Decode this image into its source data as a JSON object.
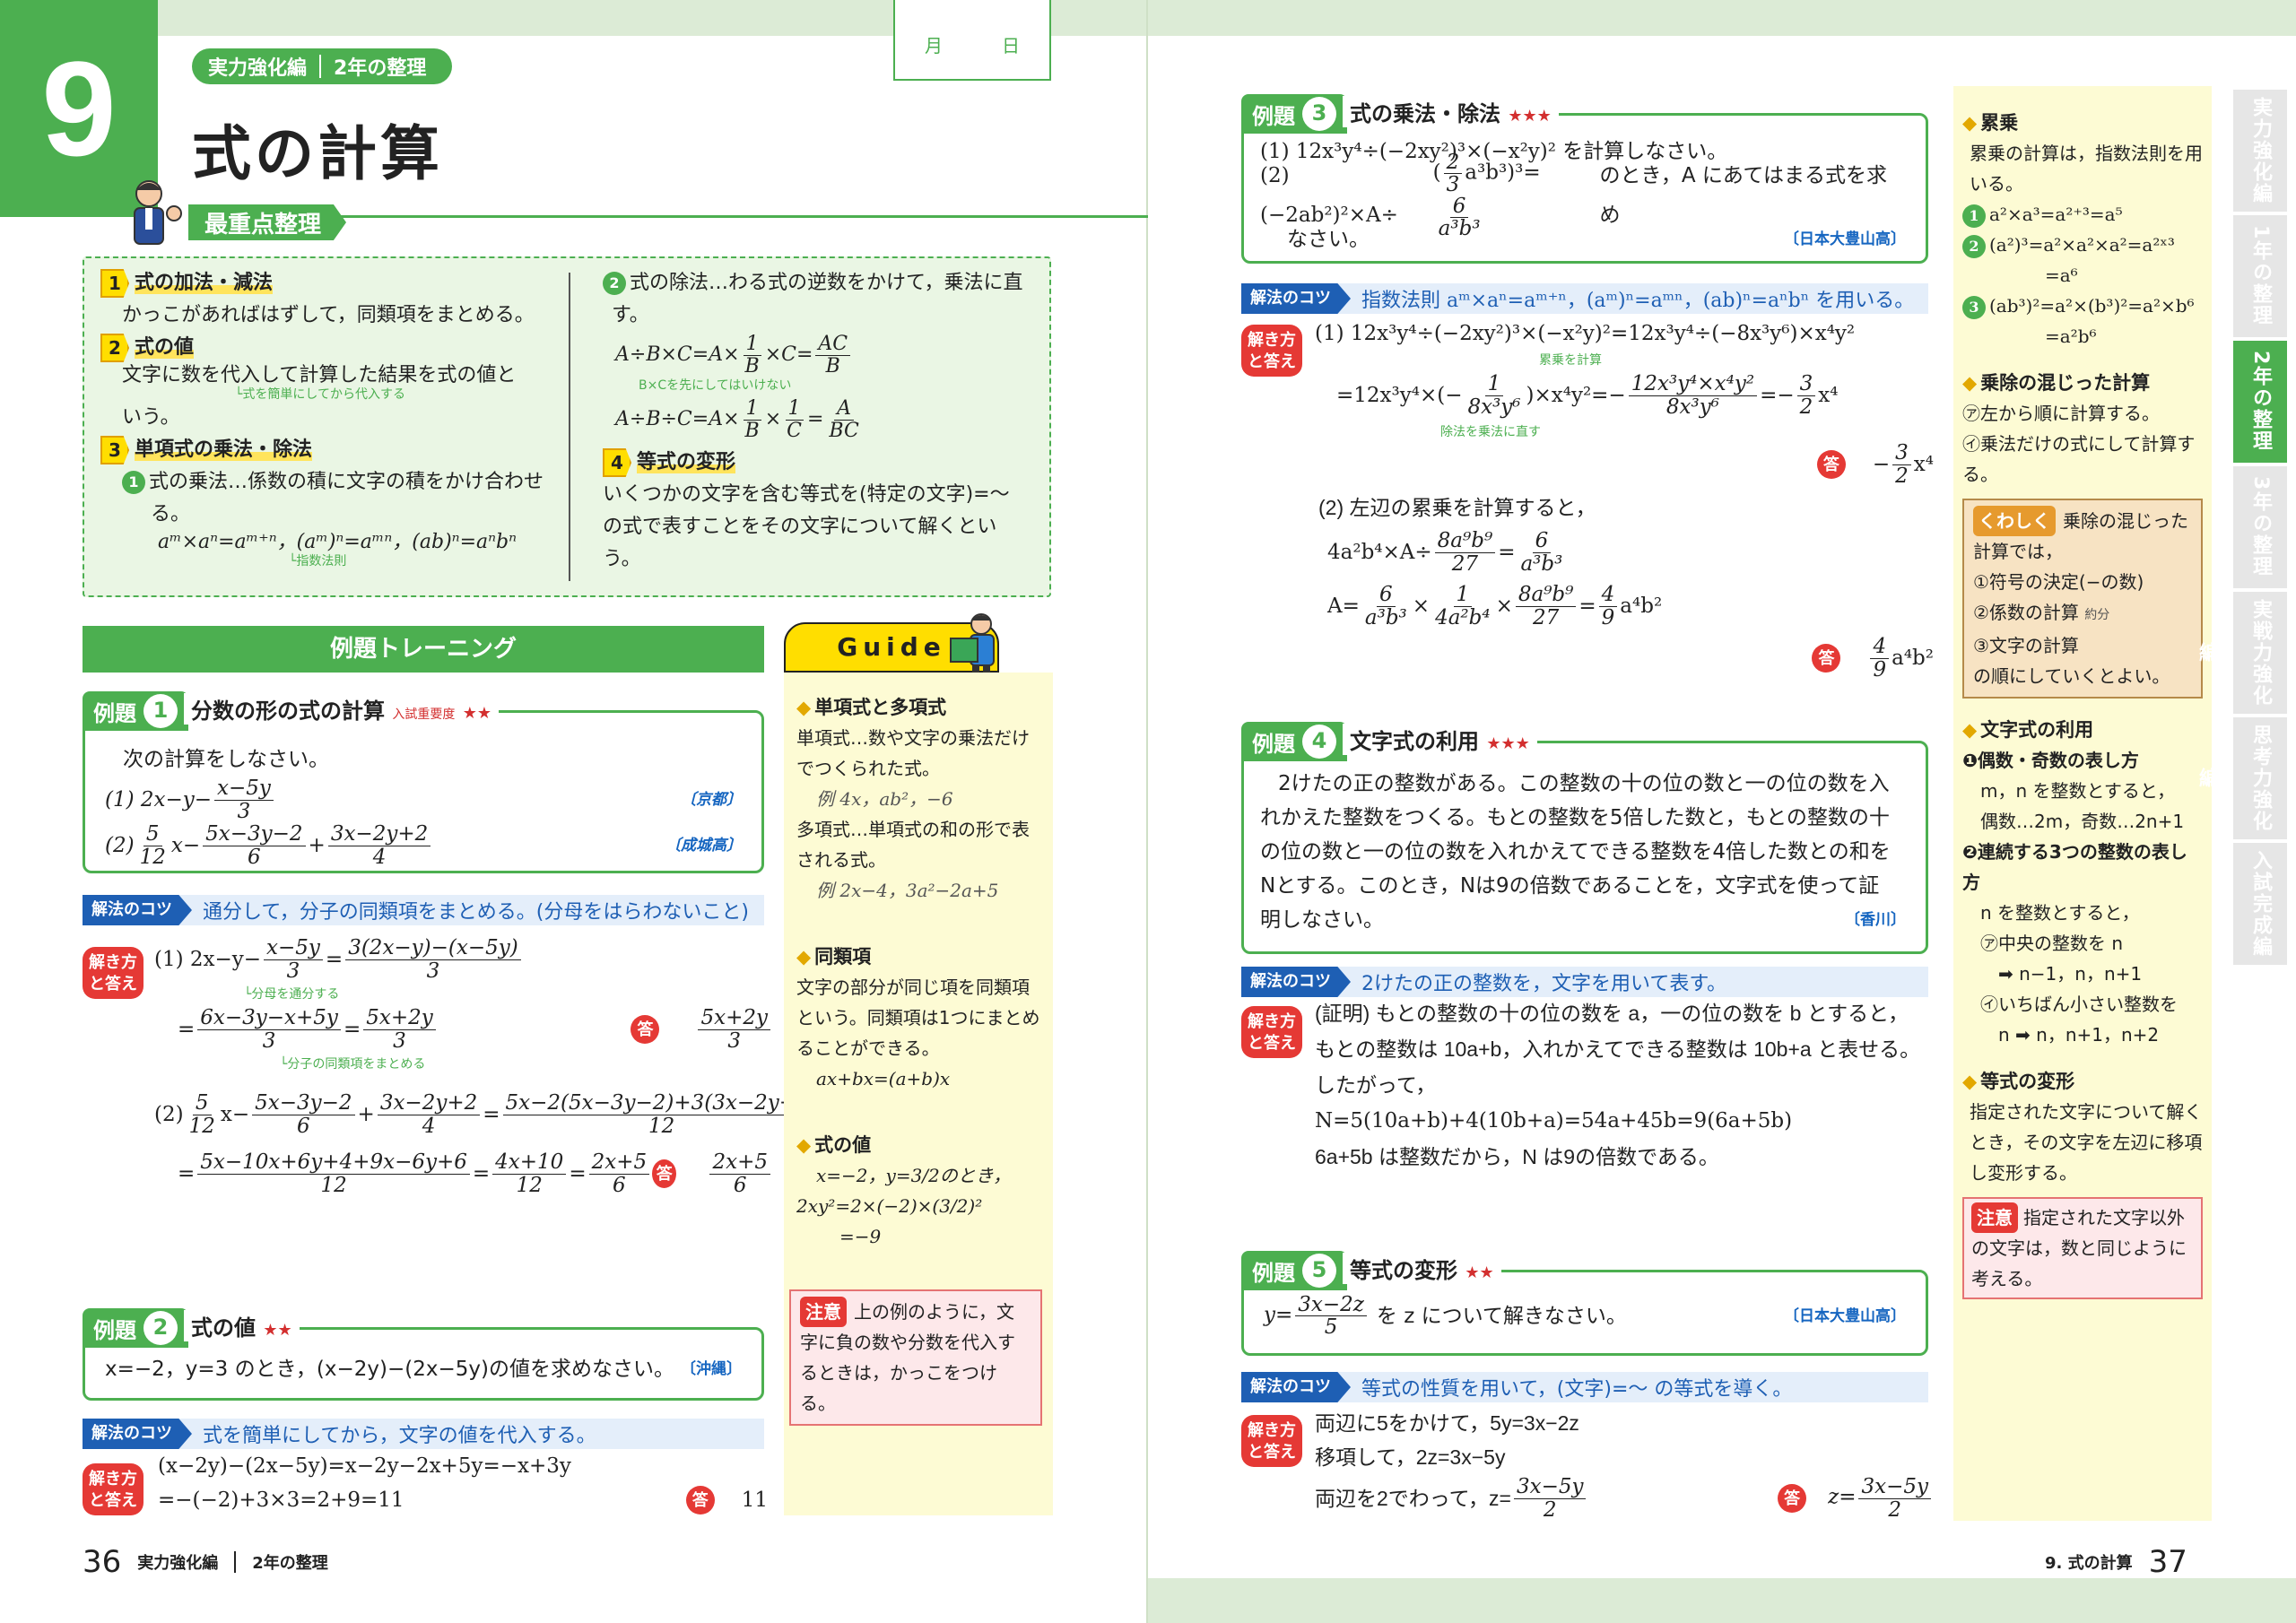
{
  "left": {
    "chapter_number": "9",
    "section_pill": {
      "a": "実力強化編",
      "b": "2年の整理"
    },
    "date_box": {
      "month": "月",
      "day": "日"
    },
    "title": "式の計算",
    "key_tag": "最重点整理",
    "key": {
      "item1": {
        "num": "1",
        "title": "式の加法・減法",
        "text": "かっこがあればはずして，同類項をまとめる。"
      },
      "item2": {
        "num": "2",
        "title": "式の値",
        "text1": "文字に数を代入して計算した結果を式の値と",
        "note": "└式を簡単にしてから代入する",
        "text2": "いう。"
      },
      "item3": {
        "num": "3",
        "title": "単項式の乗法・除法",
        "sub1": "式の乗法…係数の積に文字の積をかけ合わせ",
        "sub1b": "る。",
        "law": "aᵐ×aⁿ=aᵐ⁺ⁿ，(aᵐ)ⁿ=aᵐⁿ，(ab)ⁿ=aⁿbⁿ",
        "law_note": "└指数法則"
      },
      "div": {
        "title": "式の除法…わる式の逆数をかけて，乗法に直",
        "title2": "す。",
        "eq1": "A÷B×C=A×",
        "eq1_note": "B×Cを先にしてはいけない",
        "eq2": "A÷B÷C=A×"
      },
      "item4": {
        "num": "4",
        "title": "等式の変形",
        "text1": "いくつかの文字を含む等式を(特定の文字)=〜",
        "text2": "の式で表すことをその文字について解くとい",
        "text3": "う。"
      }
    },
    "training_bar": "例題トレーニング",
    "guide_head": "Guide",
    "ex1": {
      "label": "例題",
      "num": "1",
      "name": "分数の形の式の計算",
      "small": "入試重要度",
      "stars": "★★",
      "q": "次の計算をしなさい。",
      "p1": "(1) 2x−y−",
      "p1_src": "〔京都〕",
      "p2": "(2)",
      "p2_src": "〔成城高〕"
    },
    "kotsu1": {
      "label": "解法のコツ",
      "text": "通分して，分子の同類項をまとめる。(分母をはらわないこと)"
    },
    "ans_badge": "解き方と答え",
    "ans1": {
      "l1": "(1) 2x−y−",
      "note1": "└分母を通分する",
      "note2": "└分子の同類項をまとめる",
      "l3": "(2)"
    },
    "ex2": {
      "label": "例題",
      "num": "2",
      "name": "式の値",
      "stars": "★★",
      "q": "x=−2，y=3 のとき，(x−2y)−(2x−5y)の値を求めなさい。",
      "src": "〔沖縄〕"
    },
    "kotsu2": {
      "label": "解法のコツ",
      "text": "式を簡単にしてから，文字の値を代入する。"
    },
    "ans2": {
      "l1": "(x−2y)−(2x−5y)=x−2y−2x+5y=−x+3y",
      "l2": "=−(−2)+3×3=2+9=11",
      "final": "11"
    },
    "guide": {
      "h1": "単項式と多項式",
      "g1": "単項式…数や文字の乗法だけでつくられた式。",
      "g1e": "例 4x，ab²，−6",
      "g2": "多項式…単項式の和の形で表される式。",
      "g2e": "例 2x−4，3a²−2a+5",
      "h2": "同類項",
      "g3": "文字の部分が同じ項を同類項という。同類項は1つにまとめることができる。",
      "g3e": "ax+bx=(a+b)x",
      "h3": "式の値",
      "g4": "x=−2，y=3/2のとき，",
      "g4e": "2xy²=2×(−2)×(3/2)²",
      "g4f": "=−9"
    },
    "chuui": {
      "badge": "注意",
      "text": "上の例のように，文字に負の数や分数を代入するときは，かっこをつける。"
    },
    "footer": {
      "page": "36",
      "a": "実力強化編",
      "b": "2年の整理"
    }
  },
  "right": {
    "ex3": {
      "label": "例題",
      "num": "3",
      "name": "式の乗法・除法",
      "stars": "★★★",
      "p1": "(1) 12x³y⁴÷(−2xy²)³×(−x²y)² を計算しなさい。",
      "p2a": "(2) (−2ab²)²×A÷",
      "p2b": "のとき，A にあてはまる式を求め",
      "p2c": "なさい。",
      "src": "〔日本大豊山高〕"
    },
    "kotsu3": {
      "label": "解法のコツ",
      "text": "指数法則 aᵐ×aⁿ=aᵐ⁺ⁿ，(aᵐ)ⁿ=aᵐⁿ，(ab)ⁿ=aⁿbⁿ を用いる。"
    },
    "ans3": {
      "l1": "(1) 12x³y⁴÷(−2xy²)³×(−x²y)²=12x³y⁴÷(−8x³y⁶)×x⁴y²",
      "note1": "累乗を計算",
      "note2": "除法を乗法に直す",
      "l2": "=12x³y⁴×",
      "l3": "(2) 左辺の累乗を計算すると，",
      "l4": "4a²b⁴×A÷",
      "l5": "A="
    },
    "ex4": {
      "label": "例題",
      "num": "4",
      "name": "文字式の利用",
      "stars": "★★★",
      "q1": "2けたの正の整数がある。この整数の十の位の数と一の位の数を入",
      "q2": "れかえた整数をつくる。もとの整数を5倍した数と，もとの整数の十",
      "q3": "の位の数と一の位の数を入れかえてできる整数を4倍した数との和を",
      "q4": "Nとする。このとき，Nは9の倍数であることを，文字式を使って証",
      "q5": "明しなさい。",
      "src": "〔香川〕"
    },
    "kotsu4": {
      "label": "解法のコツ",
      "text": "2けたの正の整数を，文字を用いて表す。"
    },
    "ans4": {
      "l1": "(証明) もとの整数の十の位の数を a，一の位の数を b とすると，",
      "l2": "もとの整数は 10a+b，入れかえてできる整数は 10b+a と表せる。",
      "l3": "したがって，",
      "l4": "N=5(10a+b)+4(10b+a)=54a+45b=9(6a+5b)",
      "l5": "6a+5b は整数だから，N は9の倍数である。"
    },
    "ex5": {
      "label": "例題",
      "num": "5",
      "name": "等式の変形",
      "stars": "★★",
      "q": "を z について解きなさい。",
      "src": "〔日本大豊山高〕"
    },
    "kotsu5": {
      "label": "解法のコツ",
      "text": "等式の性質を用いて，(文字)=〜 の等式を導く。"
    },
    "ans5": {
      "l1": "両辺に5をかけて，5y=3x−2z",
      "l2": "移項して，2z=3x−5y",
      "l3": "両辺を2でわって，z="
    },
    "sidebar": {
      "h1": "累乗",
      "s1": "累乗の計算は，指数法則を用いる。",
      "s2": "a²×a³=a²⁺³=a⁵",
      "s3": "(a²)³=a²×a²×a²=a²ˣ³",
      "s3b": "=a⁶",
      "s4": "(ab³)²=a²×(b³)²=a²×b⁶",
      "s4b": "=a²b⁶",
      "h2": "乗除の混じった計算",
      "s5": "㋐左から順に計算する。",
      "s6": "㋑乗法だけの式にして計算する。",
      "kuwashiku_badge": "くわしく",
      "k1": "乗除の混じった計算では，",
      "k2": "①符号の決定(−の数)",
      "k3": "②係数の計算",
      "k3n": "約分",
      "k4": "③文字の計算",
      "k5": "の順にしていくとよい。",
      "h3": "文字式の利用",
      "s7": "❶偶数・奇数の表し方",
      "s8": "m，n を整数とすると，",
      "s9": "偶数…2m，奇数…2n+1",
      "s10": "❷連続する3つの整数の表し方",
      "s11": "n を整数とすると，",
      "s12": "㋐中央の整数を n",
      "s13": "➡ n−1，n，n+1",
      "s14": "㋑いちばん小さい整数を",
      "s15": "n ➡ n，n+1，n+2",
      "h4": "等式の変形",
      "s16": "指定された文字について解くとき，その文字を左辺に移項し変形する。",
      "chuui_badge": "注意",
      "chuui": "指定された文字以外の文字は，数と同じように考える。"
    },
    "tabs": [
      "実力強化編",
      "1年の整理",
      "2年の整理",
      "3年の整理",
      "実戦力強化編",
      "思考力強化編",
      "入試完成編"
    ],
    "active_tab": 2,
    "footer": {
      "s": "9. 式の計算",
      "page": "37"
    }
  }
}
